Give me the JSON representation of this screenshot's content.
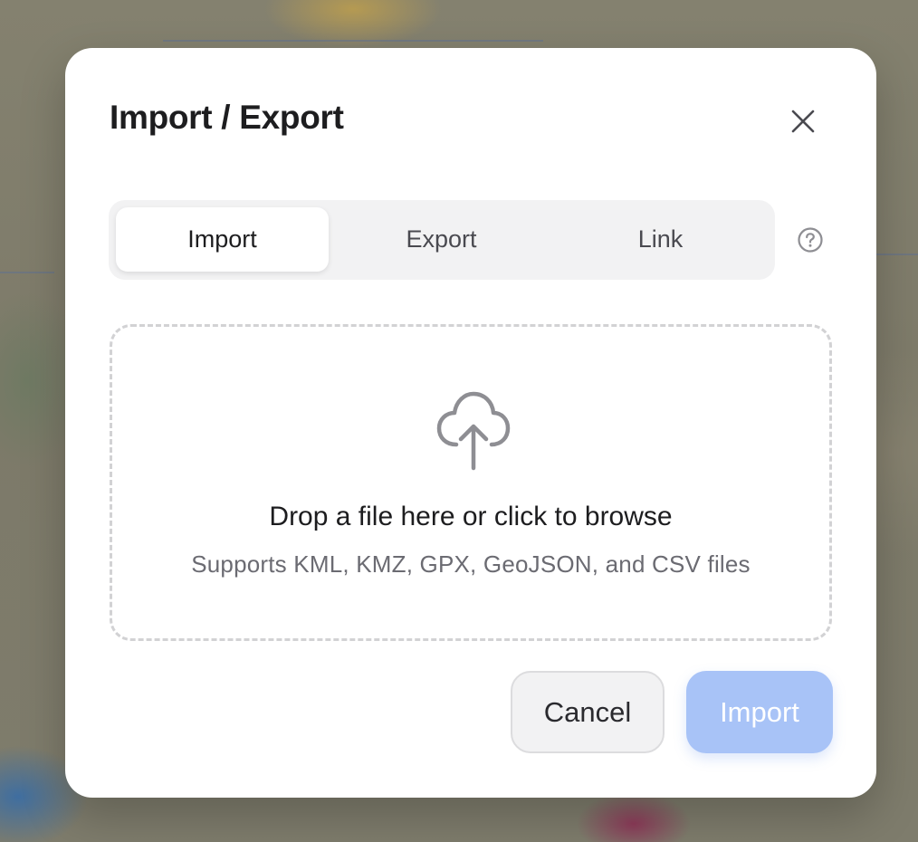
{
  "dialog": {
    "title": "Import / Export",
    "close_icon": "close-icon"
  },
  "tabs": [
    {
      "label": "Import",
      "active": true
    },
    {
      "label": "Export",
      "active": false
    },
    {
      "label": "Link",
      "active": false
    }
  ],
  "help_icon": "help-circle-icon",
  "dropzone": {
    "icon": "cloud-upload-icon",
    "title": "Drop a file here or click to browse",
    "subtitle": "Supports KML, KMZ, GPX, GeoJSON, and CSV files"
  },
  "actions": {
    "cancel_label": "Cancel",
    "import_label": "Import",
    "import_disabled": true
  },
  "colors": {
    "primary_disabled": "#a8c3f7",
    "icon_gray": "#8e8e93",
    "backdrop": "#7d7b6e"
  }
}
